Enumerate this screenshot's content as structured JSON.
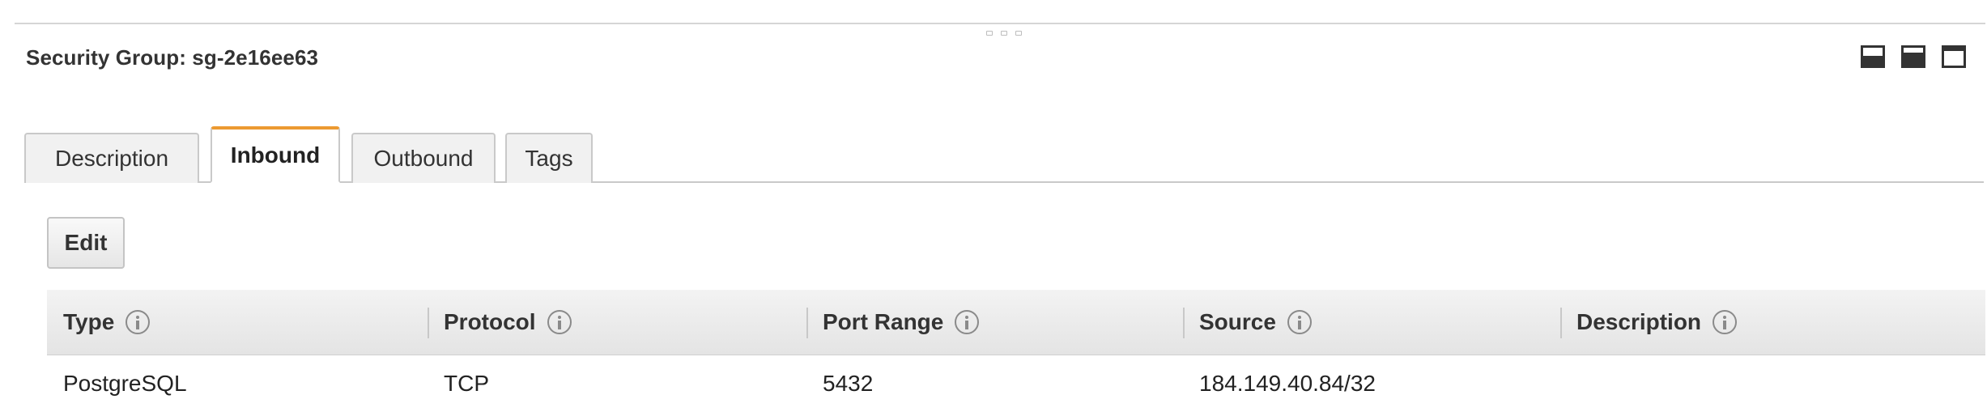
{
  "panel": {
    "title": "Security Group: sg-2e16ee63"
  },
  "layout_controls": [
    "layout-bottom-icon",
    "layout-split-icon",
    "layout-full-icon"
  ],
  "tabs": [
    {
      "label": "Description",
      "active": false
    },
    {
      "label": "Inbound",
      "active": true
    },
    {
      "label": "Outbound",
      "active": false
    },
    {
      "label": "Tags",
      "active": false
    }
  ],
  "toolbar": {
    "edit_label": "Edit"
  },
  "table": {
    "columns": [
      "Type",
      "Protocol",
      "Port Range",
      "Source",
      "Description"
    ],
    "rows": [
      [
        "PostgreSQL",
        "TCP",
        "5432",
        "184.149.40.84/32",
        ""
      ]
    ]
  },
  "colors": {
    "active_tab_accent": "#ec9a31"
  }
}
